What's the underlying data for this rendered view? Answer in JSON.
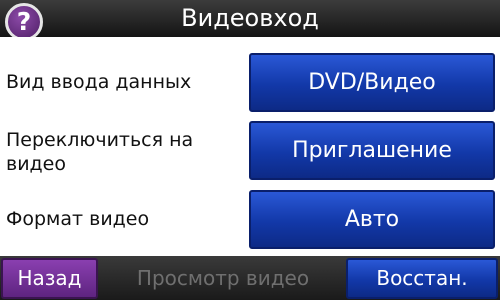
{
  "header": {
    "title": "Видеовход",
    "help_icon": "question-mark-icon",
    "help_glyph": "?"
  },
  "rows": [
    {
      "label": "Вид ввода данных",
      "value": "DVD/Видео"
    },
    {
      "label": "Переключиться на видео",
      "value": "Приглашение"
    },
    {
      "label": "Формат видео",
      "value": "Авто"
    }
  ],
  "footer": {
    "back_label": "Назад",
    "preview_label": "Просмотр видео",
    "restore_label": "Восстан."
  },
  "colors": {
    "header_bg": "#1e1e1e",
    "button_blue": "#1238a8",
    "back_purple": "#7a34a0",
    "disabled_text": "#6f6f6f",
    "help_purple": "#6a2f8a"
  }
}
